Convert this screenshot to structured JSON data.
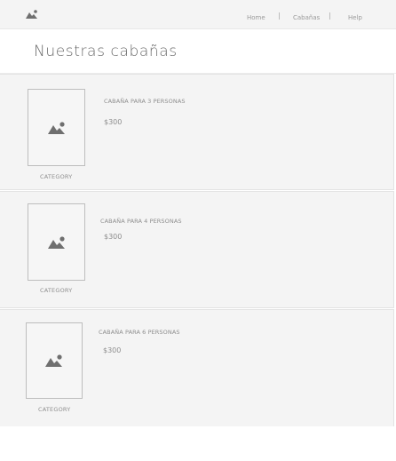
{
  "nav": {
    "logo_icon": "image-icon",
    "items": [
      {
        "label": "Home"
      },
      {
        "label": "Cabañas"
      },
      {
        "label": "Help"
      }
    ]
  },
  "page": {
    "title": "Nuestras cabañas"
  },
  "cards": [
    {
      "title": "CABAÑA PARA 3 PERSONAS",
      "price": "$300",
      "category": "CATEGORY",
      "icon": "image-placeholder-icon"
    },
    {
      "title": "CABAÑA PARA 4 PERSONAS",
      "price": "$300",
      "category": "CATEGORY",
      "icon": "image-placeholder-icon"
    },
    {
      "title": "CABAÑA PARA 6 PERSONAS",
      "price": "$300",
      "category": "CATEGORY",
      "icon": "image-placeholder-icon"
    }
  ],
  "colors": {
    "card_bg": "#f4f4f4",
    "text": "#8e8e8e",
    "icon": "#6f6f6f"
  }
}
